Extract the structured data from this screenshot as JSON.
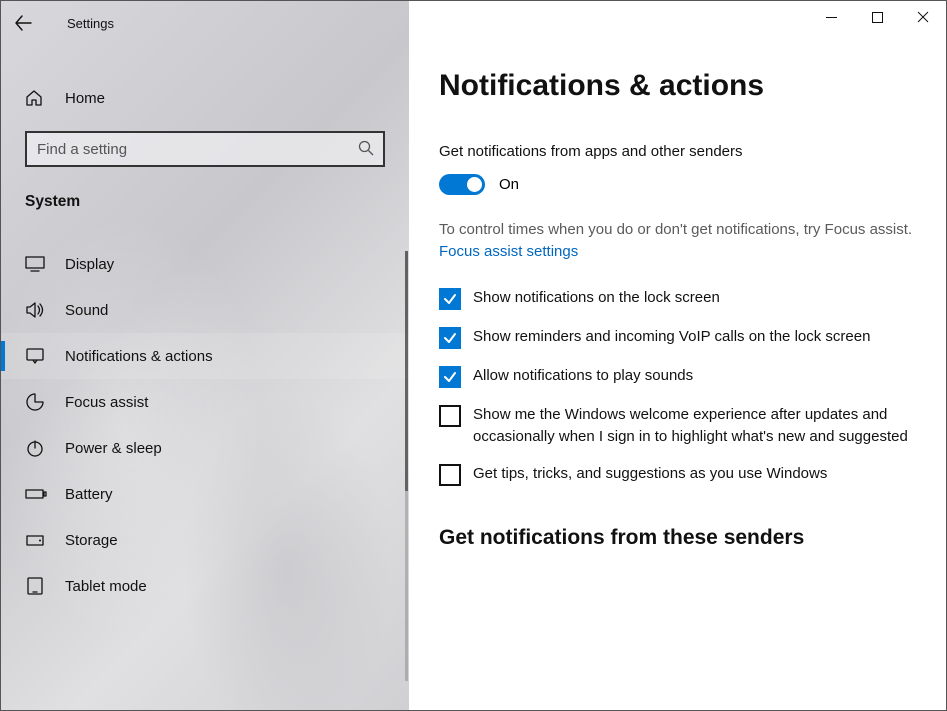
{
  "window": {
    "title": "Settings"
  },
  "nav": {
    "home_label": "Home",
    "search_placeholder": "Find a setting",
    "section_label": "System",
    "items": [
      {
        "label": "Display",
        "icon": "display",
        "selected": false
      },
      {
        "label": "Sound",
        "icon": "sound",
        "selected": false
      },
      {
        "label": "Notifications & actions",
        "icon": "notifications",
        "selected": true
      },
      {
        "label": "Focus assist",
        "icon": "focus",
        "selected": false
      },
      {
        "label": "Power & sleep",
        "icon": "power",
        "selected": false
      },
      {
        "label": "Battery",
        "icon": "battery",
        "selected": false
      },
      {
        "label": "Storage",
        "icon": "storage",
        "selected": false
      },
      {
        "label": "Tablet mode",
        "icon": "tablet",
        "selected": false
      }
    ]
  },
  "page": {
    "title": "Notifications & actions",
    "toggle_label": "Get notifications from apps and other senders",
    "toggle_state": "On",
    "desc": "To control times when you do or don't get notifications, try Focus assist.",
    "link": "Focus assist settings",
    "checks": [
      {
        "label": "Show notifications on the lock screen",
        "checked": true
      },
      {
        "label": "Show reminders and incoming VoIP calls on the lock screen",
        "checked": true
      },
      {
        "label": "Allow notifications to play sounds",
        "checked": true
      },
      {
        "label": "Show me the Windows welcome experience after updates and occasionally when I sign in to highlight what's new and suggested",
        "checked": false
      },
      {
        "label": "Get tips, tricks, and suggestions as you use Windows",
        "checked": false
      }
    ],
    "subheading": "Get notifications from these senders"
  }
}
